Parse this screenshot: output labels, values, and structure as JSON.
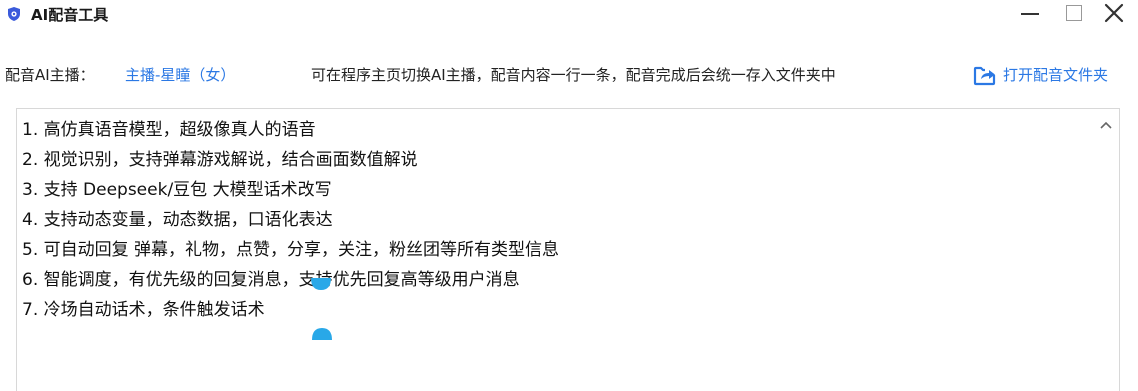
{
  "window": {
    "title": "AI配音工具",
    "icon": "shield-logo-icon",
    "controls": [
      "minimize-icon",
      "maximize-icon",
      "close-icon"
    ]
  },
  "info": {
    "anchor_label": "配音AI主播：",
    "anchor_name": "主播-星瞳（女）",
    "hint": "可在程序主页切换AI主播，配音内容一行一条，配音完成后会统一存入文件夹中",
    "open_folder_label": "打开配音文件夹",
    "open_folder_icon": "folder-share-icon"
  },
  "editor": {
    "lines": [
      "1. 高仿真语音模型，超级像真人的语音",
      "2. 视觉识别，支持弹幕游戏解说，结合画面数值解说",
      "3. 支持 Deepseek/豆包 大模型话术改写",
      "4. 支持动态变量，动态数据，口语化表达",
      "5. 可自动回复 弹幕，礼物，点赞，分享，关注，粉丝团等所有类型信息",
      "6. 智能调度，有优先级的回复消息，支持优先回复高等级用户消息",
      "7. 冷场自动话术，条件触发话术"
    ]
  },
  "colors": {
    "accent": "#2b78e4",
    "text": "#111111",
    "border": "#d8d8d8",
    "handle": "#29a8e8"
  }
}
